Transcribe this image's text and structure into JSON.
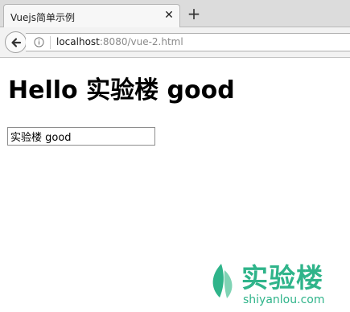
{
  "browser": {
    "tab": {
      "title": "Vuejs简单示例",
      "close_glyph": "✕"
    },
    "new_tab_glyph": "+",
    "address": {
      "host": "localhost",
      "rest": ":8080/vue-2.html"
    }
  },
  "page": {
    "heading": "Hello 实验楼 good",
    "input_value": "实验楼 good"
  },
  "watermark": {
    "name_cn": "实验楼",
    "name_en": "shiyanlou.com",
    "color": "#2fb48a"
  },
  "icons": {
    "back": "arrow-left-icon",
    "info": "info-circle-icon",
    "close": "close-icon",
    "new_tab": "plus-icon",
    "logo": "shiyanlou-leaf-logo"
  }
}
